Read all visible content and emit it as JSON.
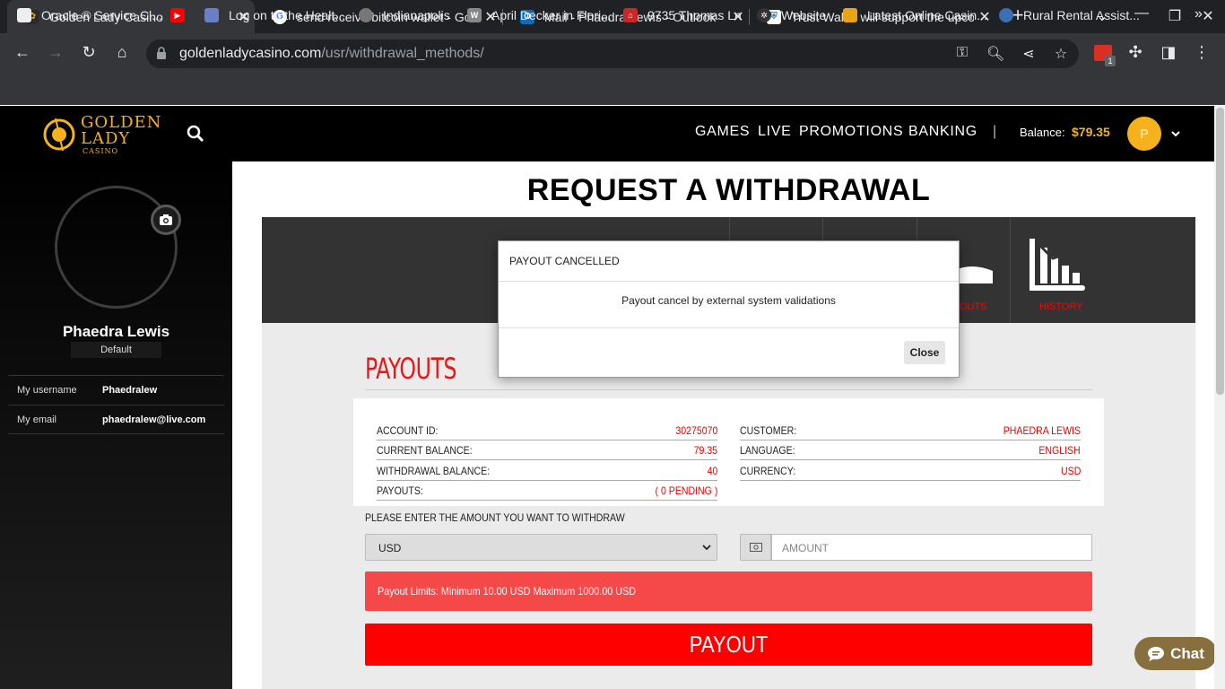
{
  "browser": {
    "tabs": [
      {
        "title": "Golden Lady Casino",
        "active": true
      },
      {
        "title": "send receive bitcoin wallet - Goo",
        "active": false
      },
      {
        "title": "Mail - Phaedra Lewis - Outlook",
        "active": false
      },
      {
        "title": "Trust Wallet will support the upco",
        "active": false
      }
    ],
    "url_domain": "goldenladycasino.com",
    "url_path": "/usr/withdrawal_methods/",
    "extension_badge": "1",
    "bookmarks": [
      {
        "label": "Oracle ® Service Cl..."
      },
      {
        "label": ""
      },
      {
        "label": "Log on to the Healt..."
      },
      {
        "label": "Indianapolis"
      },
      {
        "label": "April Decker in Flori..."
      },
      {
        "label": "9735 Thomas Ln"
      },
      {
        "label": "Website"
      },
      {
        "label": "Latest Online Casin..."
      },
      {
        "label": "Rural Rental Assist..."
      }
    ],
    "bookmarks_more": "»"
  },
  "site": {
    "logo_line1": "GOLDEN",
    "logo_line2": "LADY",
    "logo_line3": "CASINO",
    "nav": [
      "GAMES",
      "LIVE",
      "PROMOTIONS",
      "BANKING"
    ],
    "nav_divider": "|",
    "balance_label": "Balance:",
    "balance_value": "$79.35",
    "avatar_initial": "P"
  },
  "sidebar": {
    "name": "Phaedra Lewis",
    "badge": "Default",
    "rows": [
      {
        "label": "My username",
        "value": "Phaedralew"
      },
      {
        "label": "My email",
        "value": "phaedralew@live.com"
      }
    ]
  },
  "page": {
    "title": "REQUEST A WITHDRAWAL",
    "tiles": [
      {
        "label": "OUTS"
      },
      {
        "label": "HISTORY"
      }
    ],
    "section_title": "PAYOUTS",
    "info_left": [
      {
        "key": "ACCOUNT ID:",
        "value": "30275070"
      },
      {
        "key": "CURRENT BALANCE:",
        "value": "79.35"
      },
      {
        "key": "WITHDRAWAL BALANCE:",
        "value": "40"
      },
      {
        "key": "PAYOUTS:",
        "value": "( 0 PENDING )"
      }
    ],
    "info_right": [
      {
        "key": "CUSTOMER:",
        "value": "PHAEDRA LEWIS"
      },
      {
        "key": "LANGUAGE:",
        "value": "ENGLISH"
      },
      {
        "key": "CURRENCY:",
        "value": "USD"
      }
    ],
    "amount_prompt": "PLEASE ENTER THE AMOUNT YOU WANT TO WITHDRAW",
    "currency_selected": "USD",
    "amount_placeholder": "AMOUNT",
    "limits_text": "Payout Limits: Minimum 10.00 USD Maximum 1000.00 USD",
    "payout_button": "PAYOUT"
  },
  "modal": {
    "title": "PAYOUT CANCELLED",
    "message": "Payout cancel by external system validations",
    "close_label": "Close"
  },
  "chat": {
    "label": "Chat"
  },
  "colors": {
    "accent_red": "#ff0000",
    "alert_red": "#f54848",
    "gold": "#f5b21c",
    "chat_brown": "#876f3e"
  }
}
